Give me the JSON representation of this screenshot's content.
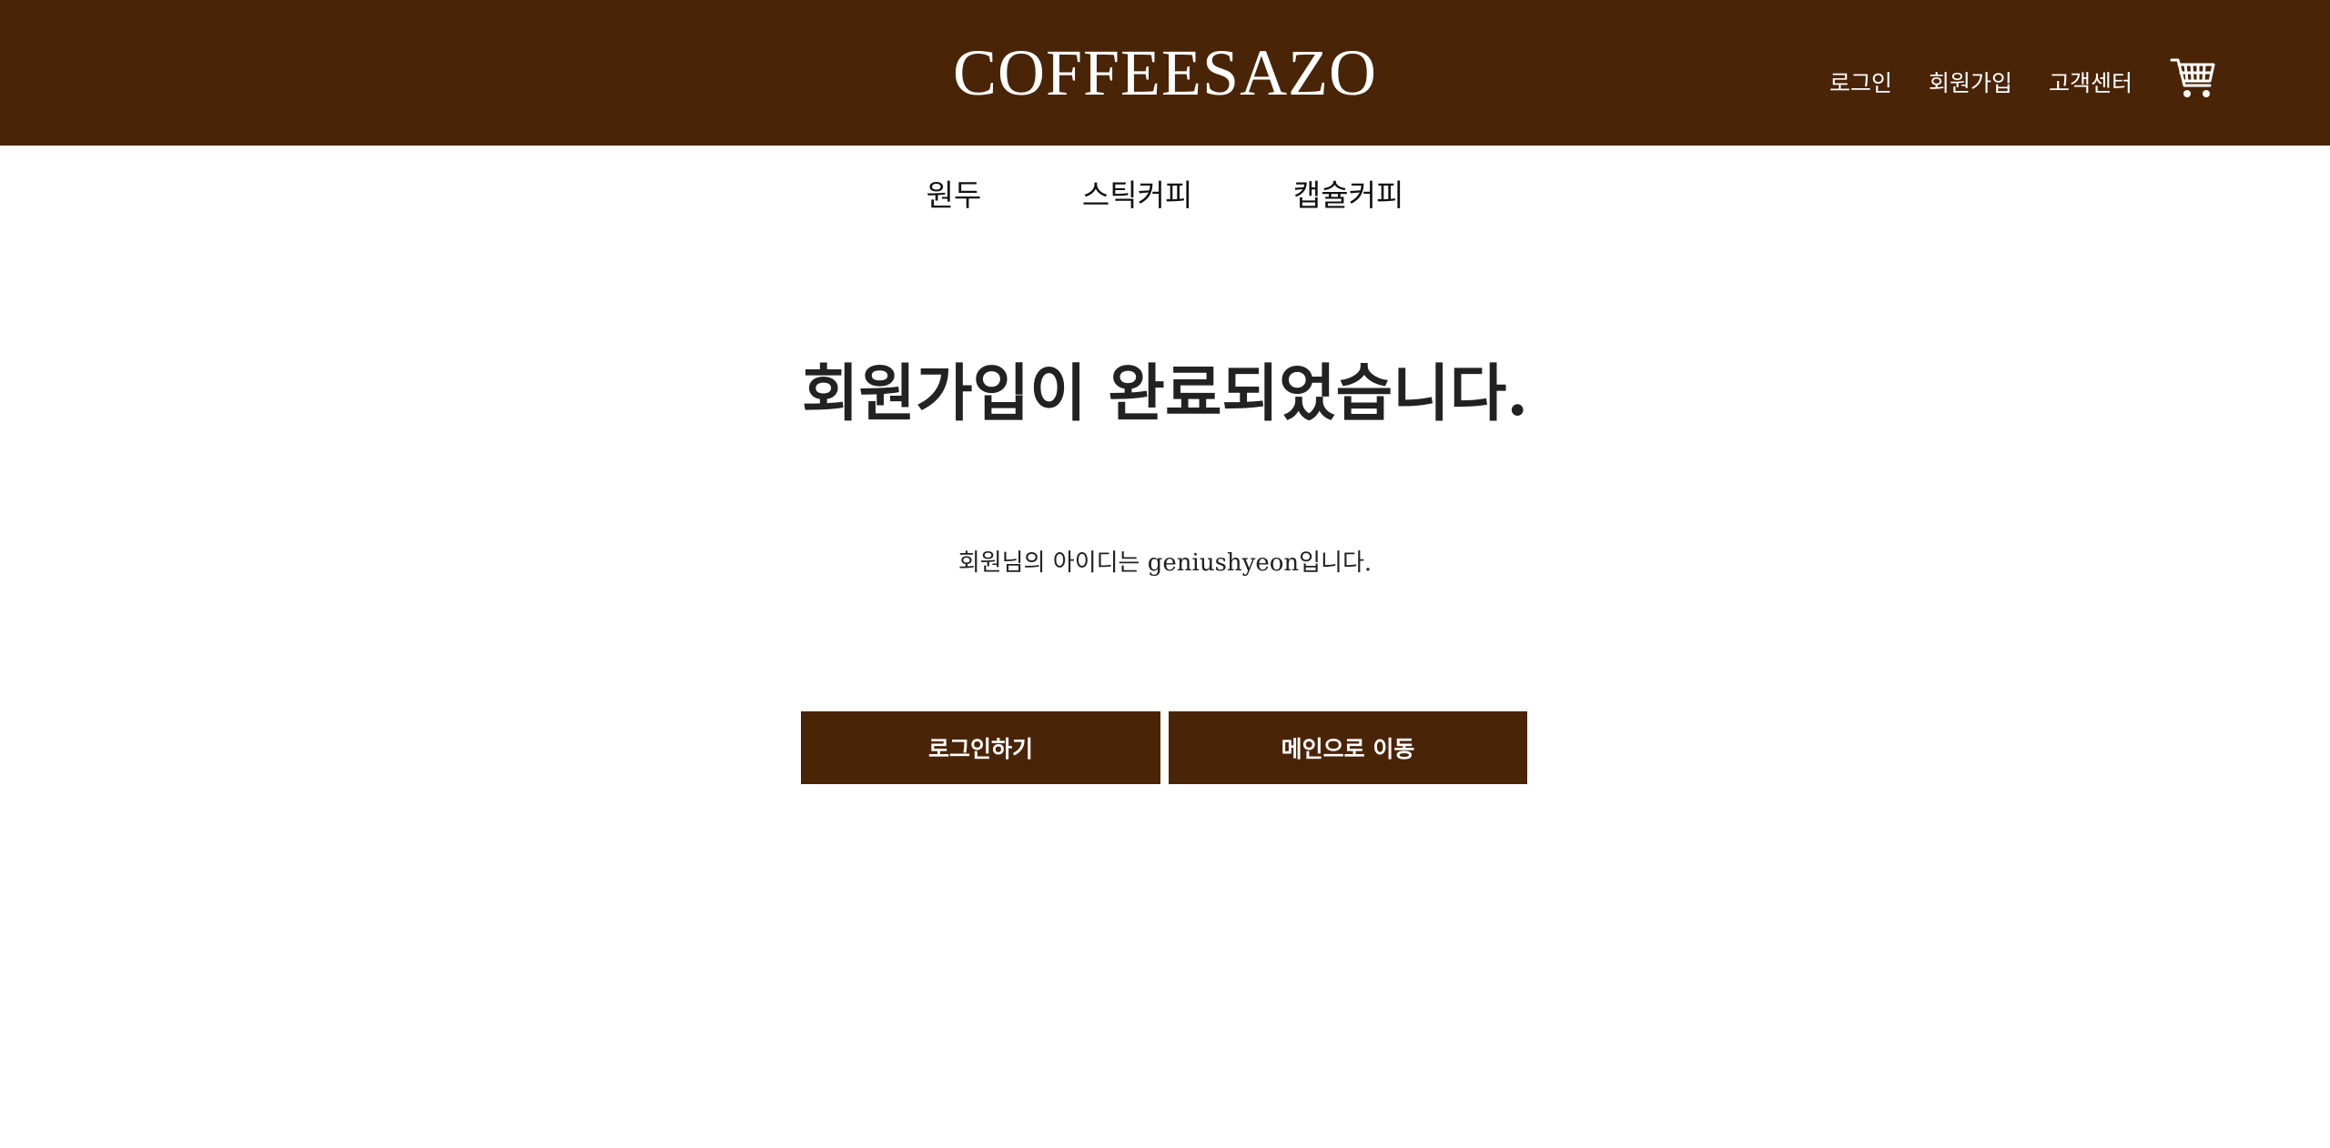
{
  "header": {
    "logo": "COFFEESAZO",
    "links": {
      "login": "로그인",
      "signup": "회원가입",
      "support": "고객센터"
    },
    "cart_icon": "shopping-cart-icon",
    "bg_color": "#4a2407"
  },
  "categories": {
    "beans": "원두",
    "stick": "스틱커피",
    "capsule": "캡슐커피"
  },
  "main": {
    "title": "회원가입이 완료되었습니다.",
    "message": "회원님의 아이디는 geniushyeon입니다."
  },
  "buttons": {
    "login": "로그인하기",
    "home": "메인으로 이동"
  }
}
